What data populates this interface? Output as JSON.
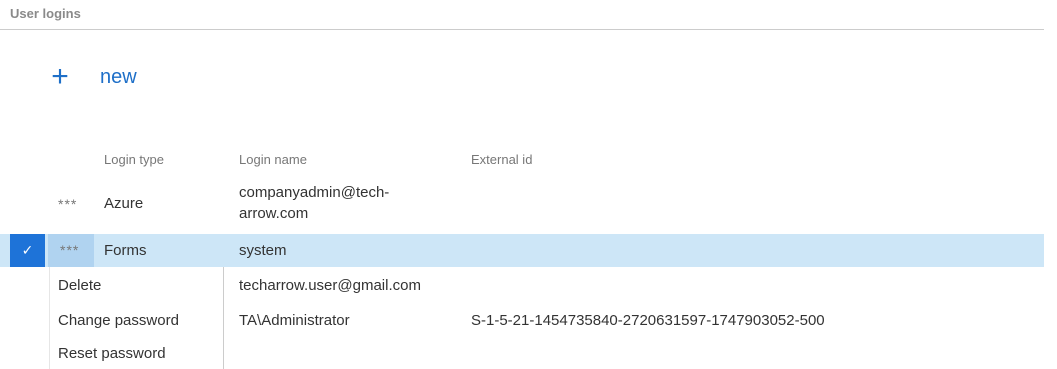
{
  "section": {
    "title": "User logins"
  },
  "actions": {
    "new_icon": "+",
    "new_label": "new"
  },
  "table": {
    "columns": [
      "Login type",
      "Login name",
      "External id"
    ],
    "rows": [
      {
        "ellipsis": "***",
        "type": "Azure",
        "name_line1": "companyadmin@tech-",
        "name_line2": "arrow.com",
        "external_id": ""
      },
      {
        "ellipsis": "***",
        "type": "Forms",
        "name": "system",
        "external_id": "",
        "selected": true,
        "check": "✓"
      },
      {
        "name": "techarrow.user@gmail.com",
        "external_id": ""
      },
      {
        "name": "TA\\Administrator",
        "external_id": "S-1-5-21-1454735840-2720631597-1747903052-500"
      }
    ]
  },
  "context_menu": {
    "items": [
      "Delete",
      "Change password",
      "Reset password"
    ]
  },
  "colors": {
    "accent": "#1e6fc8",
    "selected_row": "#cde6f7",
    "check_bg": "#1e73d8"
  }
}
